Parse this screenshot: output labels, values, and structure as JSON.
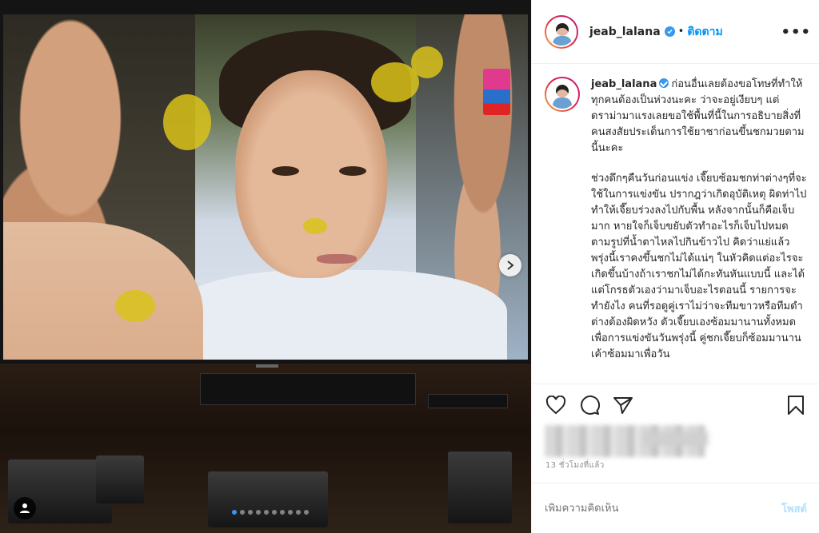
{
  "post": {
    "username": "jeab_lalana",
    "separator": "•",
    "follow_label": "ติดตาม",
    "more_label": "•••",
    "caption_line1": "ก่อนอื่นเลยต้องขอโทษที่ทำให้ทุกคนต้องเป็นห่วงนะคะ ว่าจะอยู่เงียบๆ แต่ดราม่ามาแรงเลยขอใช้พื้นที่นี้ในการอธิบายสิ่งที่คนสงสัยประเด็นการใช้ยาชาก่อนขึ้นชกมวยตามนี้นะคะ",
    "caption_para2": "ช่วงดึกๆคืนวันก่อนแข่ง เจี๊ยบซ้อมชกท่าต่างๆที่จะใช้ในการแข่งขัน ปรากฎว่าเกิดอุบัติเหตุ ผิดท่าไป ทำให้เจี๊ยบร่วงลงไปกับพื้น หลังจากนั้นก็คือเจ็บมาก หายใจก็เจ็บขยับตัวทำอะไรก็เจ็บไปหมด ตามรูปที่น้ำตาไหลไปกินข้าวไป คิดว่าแย่แล้ว พรุ่งนี้เราคงขึ้นชกไม่ได้แน่ๆ ในหัวคิดแต่อะไรจะเกิดขึ้นบ้างถ้าเราชกไม่ได้กะทันหันแบบนี้ และได้แต่โกรธตัวเองว่ามาเจ็บอะไรตอนนี้ รายการจะทำยังไง คนที่รอดูคู่เราไม่ว่าจะทีมขาวหรือทีมดำต่างต้องผิดหวัง ตัวเจี๊ยบเองซ้อมมานานทั้งหมดเพื่อการแข่งขันวันพรุ่งนี้ คู่ชกเจี๊ยบก็ซ้อมมานานเค้าซ้อมมาเพื่อวัน",
    "time_label": "13 ชั่วโมงที่แล้ว",
    "comment_placeholder": "เพิ่มความคิดเห็น",
    "post_button": "โพสต์",
    "carousel": {
      "total": 10,
      "active_index": 0
    }
  },
  "colors": {
    "accent": "#0095f6",
    "verified": "#3897f0",
    "muted": "#8e8e8e",
    "post_disabled": "#b2dffc"
  },
  "icons": [
    "verified-icon",
    "more-icon",
    "heart-icon",
    "comment-icon",
    "share-icon",
    "bookmark-icon",
    "next-arrow-icon",
    "user-tag-icon"
  ]
}
